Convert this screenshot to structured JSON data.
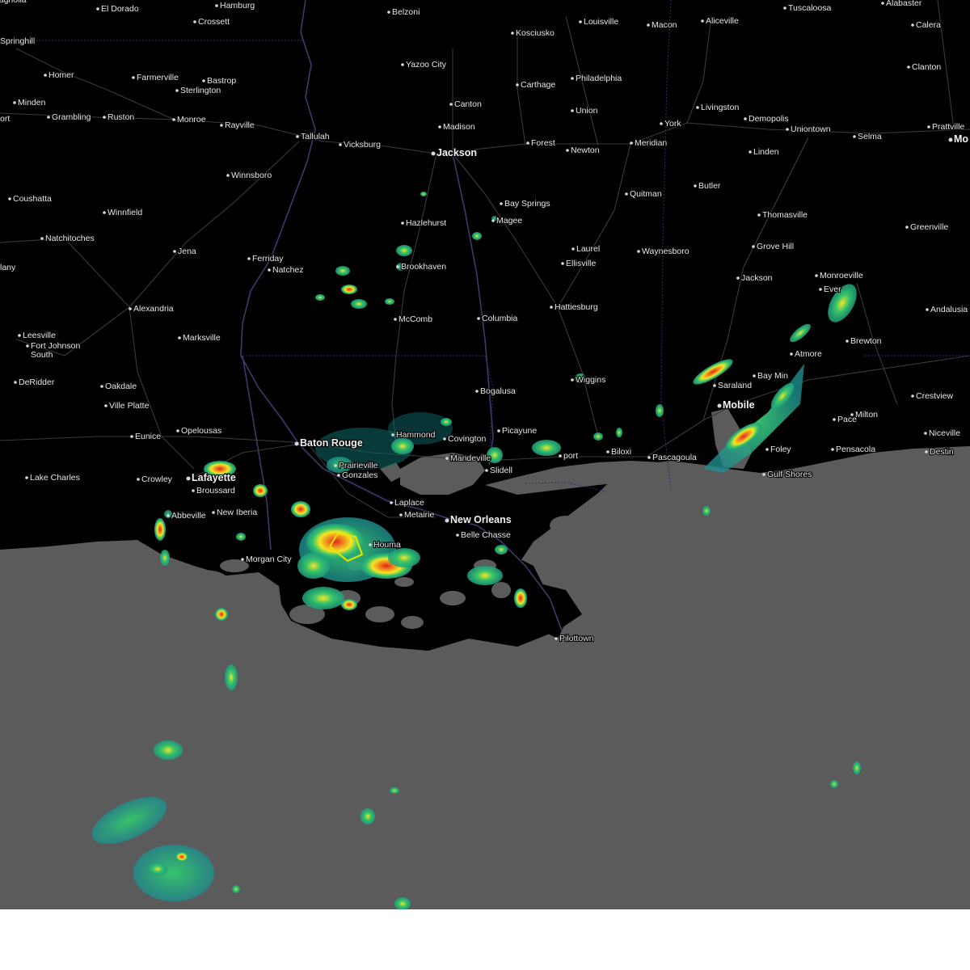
{
  "map": {
    "colors": {
      "land": "#000000",
      "water": "#5b5b5b",
      "roads": "#3a3a3a",
      "state_borders": "#26307a",
      "labels": "#e6e6e6",
      "warning_polygon": "#e6e600",
      "radar_light": "#1e9e7e",
      "radar_moderate": "#38c46a",
      "radar_heavy": "#f5e625",
      "radar_intense": "#f08c1e",
      "radar_extreme": "#e0241e"
    },
    "cities": [
      {
        "id": "magnolia",
        "name": "Magnolia"
      },
      {
        "id": "el-dorado",
        "name": "El Dorado"
      },
      {
        "id": "hamburg",
        "name": "Hamburg"
      },
      {
        "id": "crossett",
        "name": "Crossett"
      },
      {
        "id": "belzoni",
        "name": "Belzoni"
      },
      {
        "id": "louisville",
        "name": "Louisville"
      },
      {
        "id": "macon",
        "name": "Macon"
      },
      {
        "id": "aliceville",
        "name": "Aliceville"
      },
      {
        "id": "tuscaloosa",
        "name": "Tuscaloosa"
      },
      {
        "id": "alabaster",
        "name": "Alabaster"
      },
      {
        "id": "springhill",
        "name": "Springhill"
      },
      {
        "id": "kosciusko",
        "name": "Kosciusko"
      },
      {
        "id": "calera",
        "name": "Calera"
      },
      {
        "id": "yazoo-city",
        "name": "Yazoo City"
      },
      {
        "id": "homer",
        "name": "Homer"
      },
      {
        "id": "farmerville",
        "name": "Farmerville"
      },
      {
        "id": "bastrop",
        "name": "Bastrop"
      },
      {
        "id": "clanton",
        "name": "Clanton"
      },
      {
        "id": "sterlington",
        "name": "Sterlington"
      },
      {
        "id": "philadelphia",
        "name": "Philadelphia"
      },
      {
        "id": "carthage",
        "name": "Carthage"
      },
      {
        "id": "minden",
        "name": "Minden"
      },
      {
        "id": "canton",
        "name": "Canton"
      },
      {
        "id": "livingston",
        "name": "Livingston"
      },
      {
        "id": "union",
        "name": "Union"
      },
      {
        "id": "grambling",
        "name": "Grambling"
      },
      {
        "id": "ruston",
        "name": "Ruston"
      },
      {
        "id": "demopolis",
        "name": "Demopolis"
      },
      {
        "id": "ort",
        "name": "ort"
      },
      {
        "id": "monroe",
        "name": "Monroe"
      },
      {
        "id": "rayville",
        "name": "Rayville"
      },
      {
        "id": "york",
        "name": "York"
      },
      {
        "id": "prattville",
        "name": "Prattville"
      },
      {
        "id": "madison",
        "name": "Madison"
      },
      {
        "id": "uniontown",
        "name": "Uniontown"
      },
      {
        "id": "tallulah",
        "name": "Tallulah"
      },
      {
        "id": "selma",
        "name": "Selma"
      },
      {
        "id": "mo",
        "name": "Mo"
      },
      {
        "id": "forest",
        "name": "Forest"
      },
      {
        "id": "meridian",
        "name": "Meridian"
      },
      {
        "id": "vicksburg",
        "name": "Vicksburg"
      },
      {
        "id": "newton",
        "name": "Newton"
      },
      {
        "id": "linden",
        "name": "Linden"
      },
      {
        "id": "jackson",
        "name": "Jackson"
      },
      {
        "id": "winnsboro",
        "name": "Winnsboro"
      },
      {
        "id": "butler",
        "name": "Butler"
      },
      {
        "id": "quitman",
        "name": "Quitman"
      },
      {
        "id": "coushatta",
        "name": "Coushatta"
      },
      {
        "id": "bay-springs",
        "name": "Bay Springs"
      },
      {
        "id": "winnfield",
        "name": "Winnfield"
      },
      {
        "id": "thomasville",
        "name": "Thomasville"
      },
      {
        "id": "hazlehurst",
        "name": "Hazlehurst"
      },
      {
        "id": "magee",
        "name": "Magee"
      },
      {
        "id": "greenville",
        "name": "Greenville"
      },
      {
        "id": "natchitoches",
        "name": "Natchitoches"
      },
      {
        "id": "grove-hill",
        "name": "Grove Hill"
      },
      {
        "id": "laurel",
        "name": "Laurel"
      },
      {
        "id": "jena",
        "name": "Jena"
      },
      {
        "id": "waynesboro",
        "name": "Waynesboro"
      },
      {
        "id": "ferriday",
        "name": "Ferriday"
      },
      {
        "id": "ellisville",
        "name": "Ellisville"
      },
      {
        "id": "brookhaven",
        "name": "Brookhaven"
      },
      {
        "id": "lany",
        "name": "lany"
      },
      {
        "id": "natchez",
        "name": "Natchez"
      },
      {
        "id": "monroeville",
        "name": "Monroeville"
      },
      {
        "id": "jackson-al",
        "name": "Jackson"
      },
      {
        "id": "evergreen",
        "name": "Ever"
      },
      {
        "id": "alexandria",
        "name": "Alexandria"
      },
      {
        "id": "hattiesburg",
        "name": "Hattiesburg"
      },
      {
        "id": "andalusia",
        "name": "Andalusia"
      },
      {
        "id": "mccomb",
        "name": "McComb"
      },
      {
        "id": "columbia",
        "name": "Columbia"
      },
      {
        "id": "leesville",
        "name": "Leesville"
      },
      {
        "id": "marksville",
        "name": "Marksville"
      },
      {
        "id": "brewton",
        "name": "Brewton"
      },
      {
        "id": "fort-johnson-south",
        "name": "Fort Johnson\nSouth"
      },
      {
        "id": "atmore",
        "name": "Atmore"
      },
      {
        "id": "deridder",
        "name": "DeRidder"
      },
      {
        "id": "wiggins",
        "name": "Wiggins"
      },
      {
        "id": "oakdale",
        "name": "Oakdale"
      },
      {
        "id": "saraland",
        "name": "Saraland"
      },
      {
        "id": "bay-minette",
        "name": "Bay Min"
      },
      {
        "id": "crestview",
        "name": "Crestview"
      },
      {
        "id": "bogalusa",
        "name": "Bogalusa"
      },
      {
        "id": "ville-platte",
        "name": "Ville Platte"
      },
      {
        "id": "mobile",
        "name": "Mobile"
      },
      {
        "id": "milton",
        "name": "Milton"
      },
      {
        "id": "hammond",
        "name": "Hammond"
      },
      {
        "id": "pace",
        "name": "Pace"
      },
      {
        "id": "niceville",
        "name": "Niceville"
      },
      {
        "id": "opelousas",
        "name": "Opelousas"
      },
      {
        "id": "picayune",
        "name": "Picayune"
      },
      {
        "id": "eunice",
        "name": "Eunice"
      },
      {
        "id": "covington",
        "name": "Covington"
      },
      {
        "id": "baton-rouge",
        "name": "Baton Rouge"
      },
      {
        "id": "biloxi",
        "name": "Biloxi"
      },
      {
        "id": "gulfport",
        "name": "port"
      },
      {
        "id": "pascagoula",
        "name": "Pascagoula"
      },
      {
        "id": "mandeville",
        "name": "Mandeville"
      },
      {
        "id": "foley",
        "name": "Foley"
      },
      {
        "id": "pensacola",
        "name": "Pensacola"
      },
      {
        "id": "destin",
        "name": "Destin"
      },
      {
        "id": "prairieville",
        "name": "Prairieville"
      },
      {
        "id": "slidell",
        "name": "Slidell"
      },
      {
        "id": "lafayette",
        "name": "Lafayette"
      },
      {
        "id": "gonzales",
        "name": "Gonzales"
      },
      {
        "id": "gulf-shores",
        "name": "Gulf Shores"
      },
      {
        "id": "lake-charles",
        "name": "Lake Charles"
      },
      {
        "id": "crowley",
        "name": "Crowley"
      },
      {
        "id": "broussard",
        "name": "Broussard"
      },
      {
        "id": "laplace",
        "name": "Laplace"
      },
      {
        "id": "new-iberia",
        "name": "New Iberia"
      },
      {
        "id": "metairie",
        "name": "Metairie"
      },
      {
        "id": "abbeville",
        "name": "Abbeville"
      },
      {
        "id": "new-orleans",
        "name": "New Orleans"
      },
      {
        "id": "belle-chasse",
        "name": "Belle Chasse"
      },
      {
        "id": "houma",
        "name": "Houma"
      },
      {
        "id": "morgan-city",
        "name": "Morgan City"
      },
      {
        "id": "pilottown",
        "name": "Pilottown"
      }
    ]
  }
}
